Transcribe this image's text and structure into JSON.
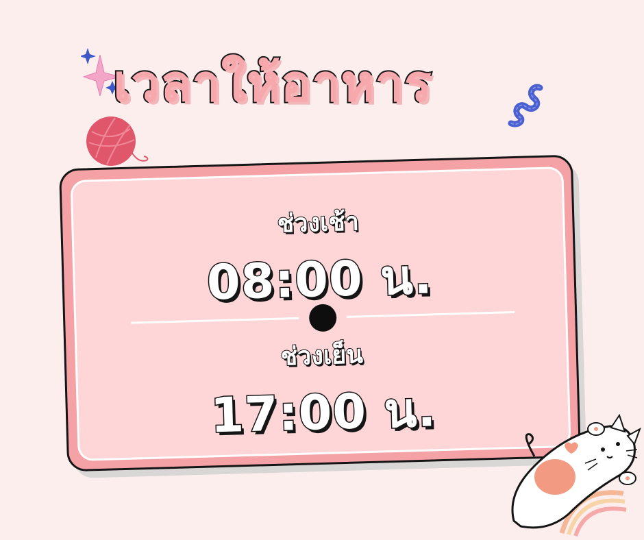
{
  "title": "เวลาให้อาหาร",
  "morning": {
    "label": "ช่วงเช้า",
    "time": "08:00 น."
  },
  "evening": {
    "label": "ช่วงเย็น",
    "time": "17:00 น."
  },
  "colors": {
    "background": "#fdeeee",
    "card_outer": "#f5a2a6",
    "card_inner": "#fed6d8",
    "title_fill": "#f7a8ad",
    "outline": "#151515",
    "yarn": "#e0576b",
    "accent_blue": "#4a5fd0"
  },
  "decorations": [
    "sparkle-icon",
    "yarn-ball-icon",
    "squiggle-icon",
    "cat-illustration"
  ]
}
